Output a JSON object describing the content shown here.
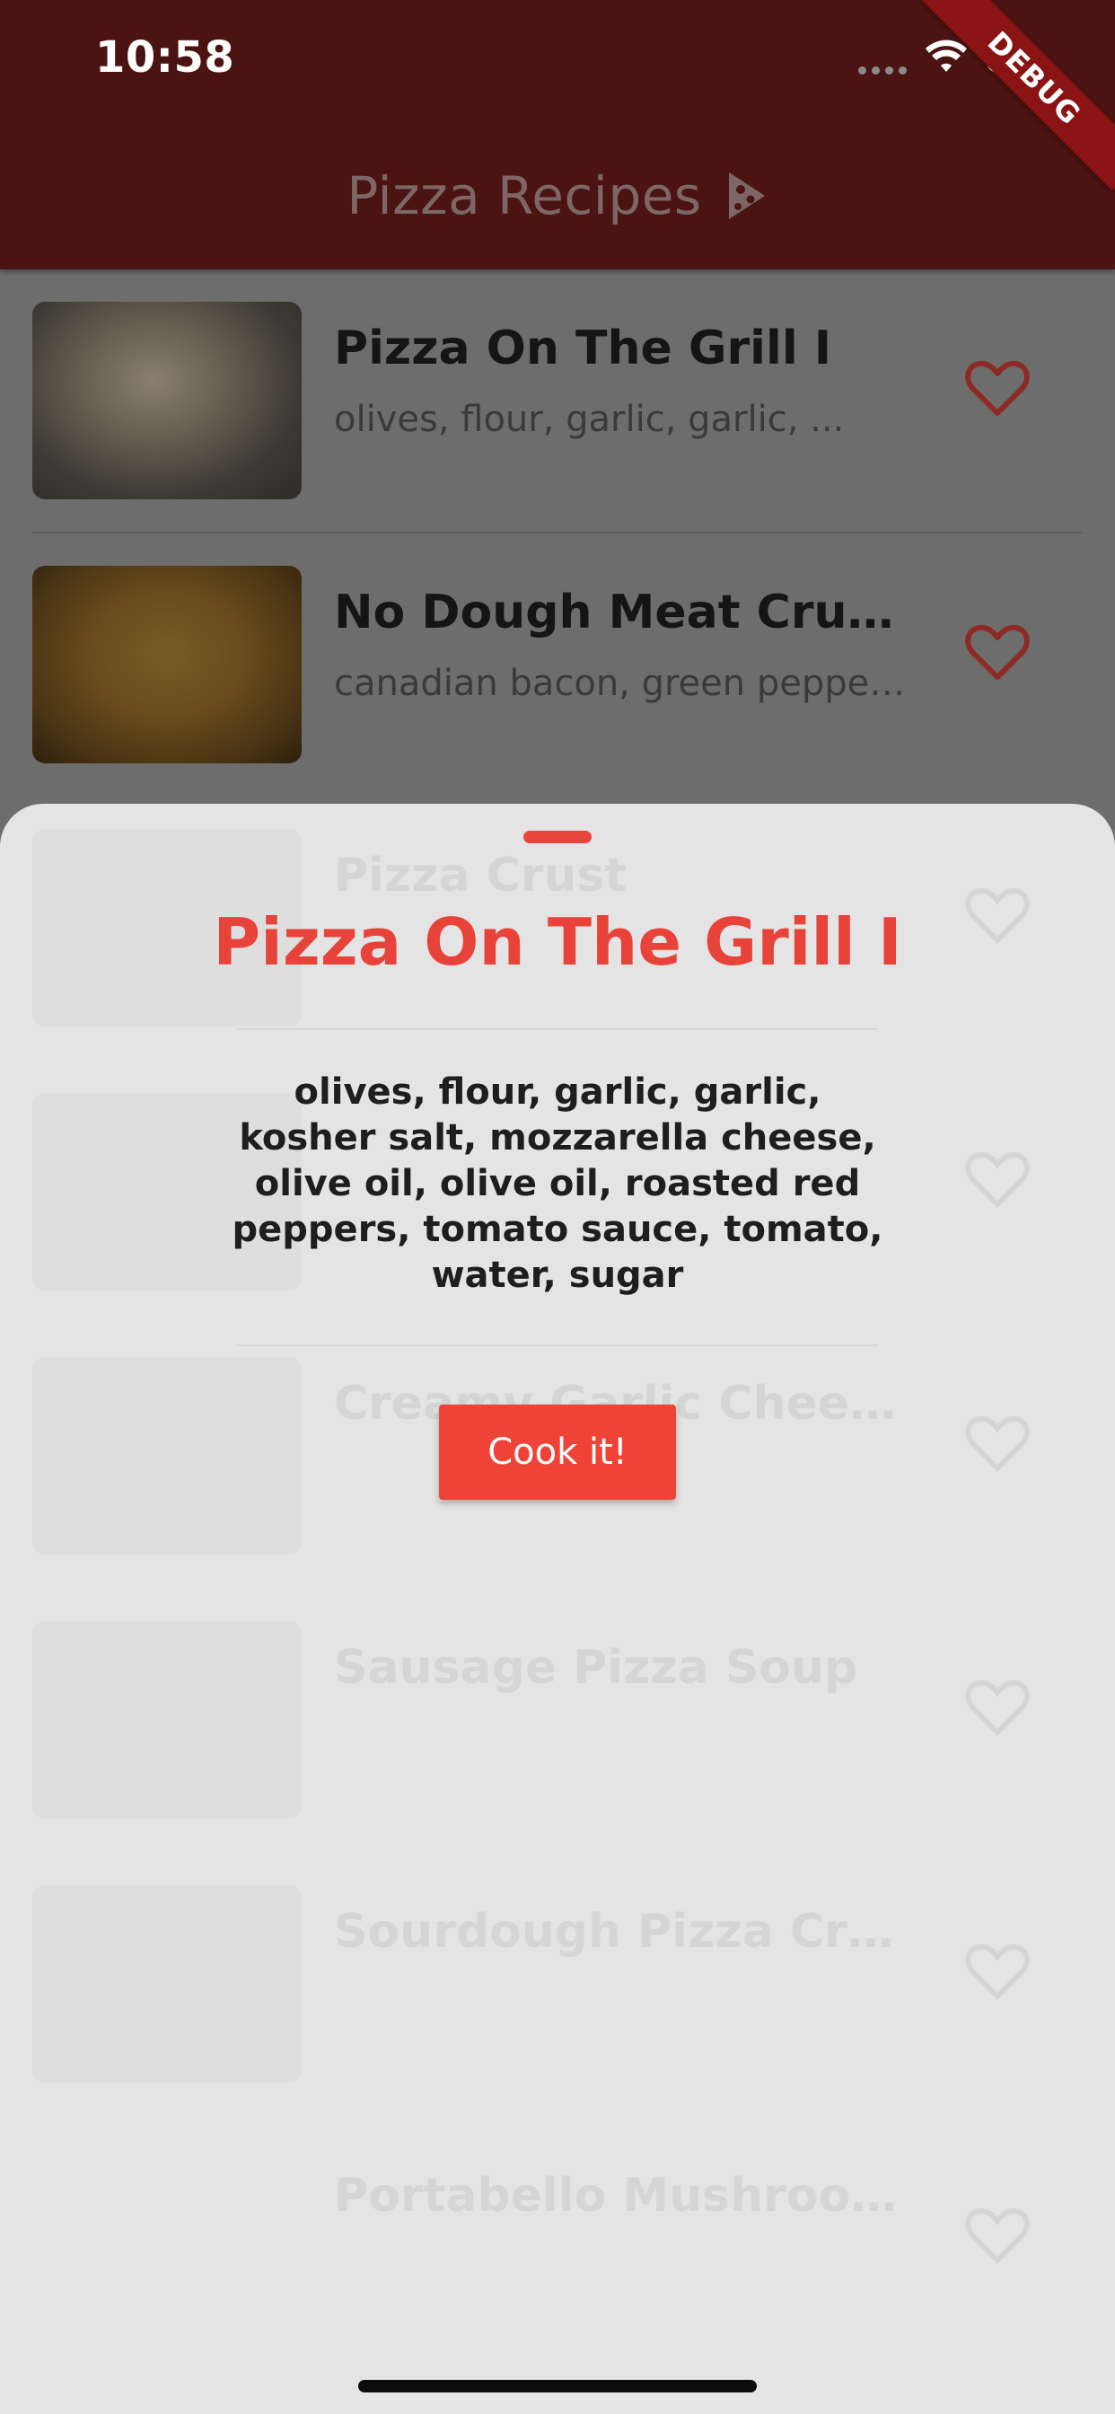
{
  "status_bar": {
    "time": "10:58",
    "icons": [
      "signal-dots-icon",
      "wifi-icon",
      "battery-icon"
    ]
  },
  "debug_banner": "DEBUG",
  "app_bar": {
    "title": "Pizza Recipes",
    "icon": "pizza-slice-icon"
  },
  "recipes": [
    {
      "title": "Pizza On The Grill I",
      "subtitle": "olives, flour, garlic, garlic, ...",
      "favorite_icon": "heart-outline-icon"
    },
    {
      "title": "No Dough Meat Crust...",
      "subtitle": "canadian bacon, green pepper...",
      "favorite_icon": "heart-outline-icon"
    }
  ],
  "background_list": [
    {
      "title": "Pizza Crust",
      "subtitle": ""
    },
    {
      "title": "",
      "subtitle": ""
    },
    {
      "title": "Creamy Garlic Chees...",
      "subtitle": ""
    },
    {
      "title": "Sausage Pizza Soup",
      "subtitle": ""
    },
    {
      "title": "Sourdough Pizza Crust",
      "subtitle": ""
    },
    {
      "title": "Portabello Mushroom...",
      "subtitle": ""
    }
  ],
  "sheet": {
    "title": "Pizza On The Grill I",
    "ingredients": "olives, flour, garlic, garlic, kosher salt, mozzarella cheese, olive oil, olive oil, roasted red peppers, tomato sauce, tomato, water, sugar",
    "button_label": "Cook it!"
  },
  "colors": {
    "app_bar": "#4b1312",
    "accent": "#ef4338",
    "scrim": "#6d6d6d",
    "sheet": "#ececec"
  }
}
